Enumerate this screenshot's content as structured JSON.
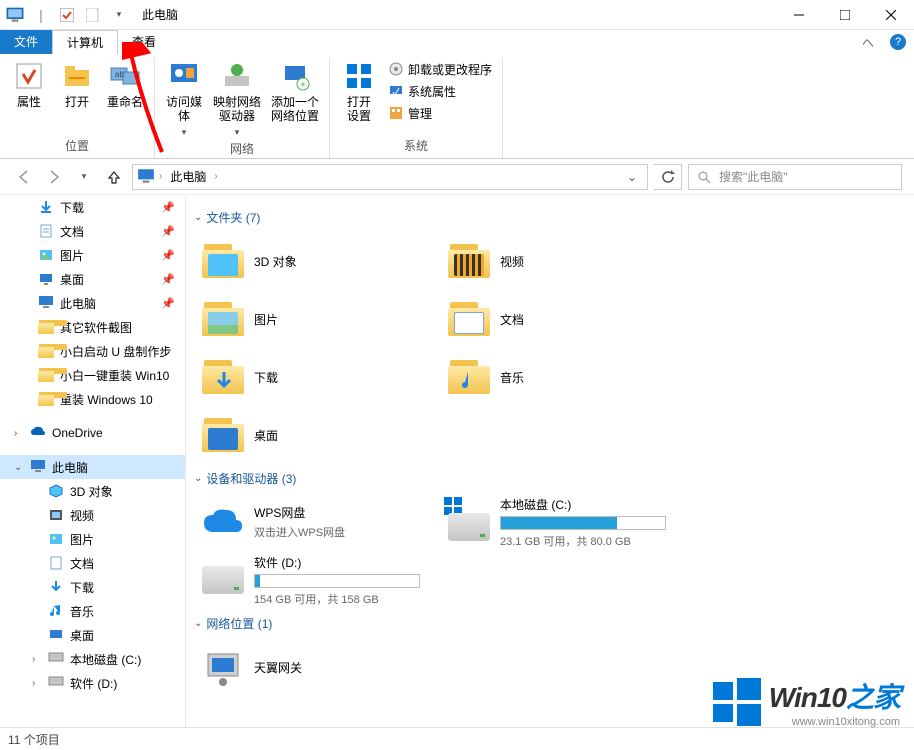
{
  "window_title": "此电脑",
  "tabs": {
    "file": "文件",
    "computer": "计算机",
    "view": "查看"
  },
  "ribbon": {
    "loc": {
      "props": "属性",
      "open": "打开",
      "rename": "重命名",
      "group": "位置"
    },
    "net": {
      "media": "访问媒体",
      "map": "映射网络\n驱动器",
      "addloc": "添加一个\n网络位置",
      "group": "网络"
    },
    "sys": {
      "opensettings": "打开\n设置",
      "uninstall": "卸载或更改程序",
      "sysprops": "系统属性",
      "manage": "管理",
      "group": "系统"
    }
  },
  "breadcrumb": {
    "root": "此电脑"
  },
  "search_placeholder": "搜索\"此电脑\"",
  "nav": {
    "quick": [
      {
        "label": "下载",
        "pin": true
      },
      {
        "label": "文档",
        "pin": true
      },
      {
        "label": "图片",
        "pin": true
      },
      {
        "label": "桌面",
        "pin": true
      },
      {
        "label": "此电脑",
        "pin": true
      },
      {
        "label": "其它软件截图"
      },
      {
        "label": "小白启动 U 盘制作步"
      },
      {
        "label": "小白一键重装 Win10"
      },
      {
        "label": "重装 Windows 10"
      }
    ],
    "onedrive": "OneDrive",
    "thispc": "此电脑",
    "pc_children": [
      "3D 对象",
      "视频",
      "图片",
      "文档",
      "下载",
      "音乐",
      "桌面",
      "本地磁盘 (C:)",
      "软件 (D:)"
    ]
  },
  "sections": {
    "folders": {
      "title": "文件夹 (7)",
      "items": [
        "3D 对象",
        "视频",
        "图片",
        "文档",
        "下载",
        "音乐",
        "桌面"
      ]
    },
    "devices": {
      "title": "设备和驱动器 (3)",
      "wps": {
        "name": "WPS网盘",
        "sub": "双击进入WPS网盘"
      },
      "c": {
        "name": "本地磁盘 (C:)",
        "sub": "23.1 GB 可用，共 80.0 GB",
        "fill": 71
      },
      "d": {
        "name": "软件 (D:)",
        "sub": "154 GB 可用，共 158 GB",
        "fill": 3
      }
    },
    "network": {
      "title": "网络位置 (1)",
      "item": "天翼网关"
    }
  },
  "status": "11 个项目",
  "watermark": {
    "main_a": "Win10",
    "main_b": "之家",
    "url": "www.win10xitong.com"
  }
}
